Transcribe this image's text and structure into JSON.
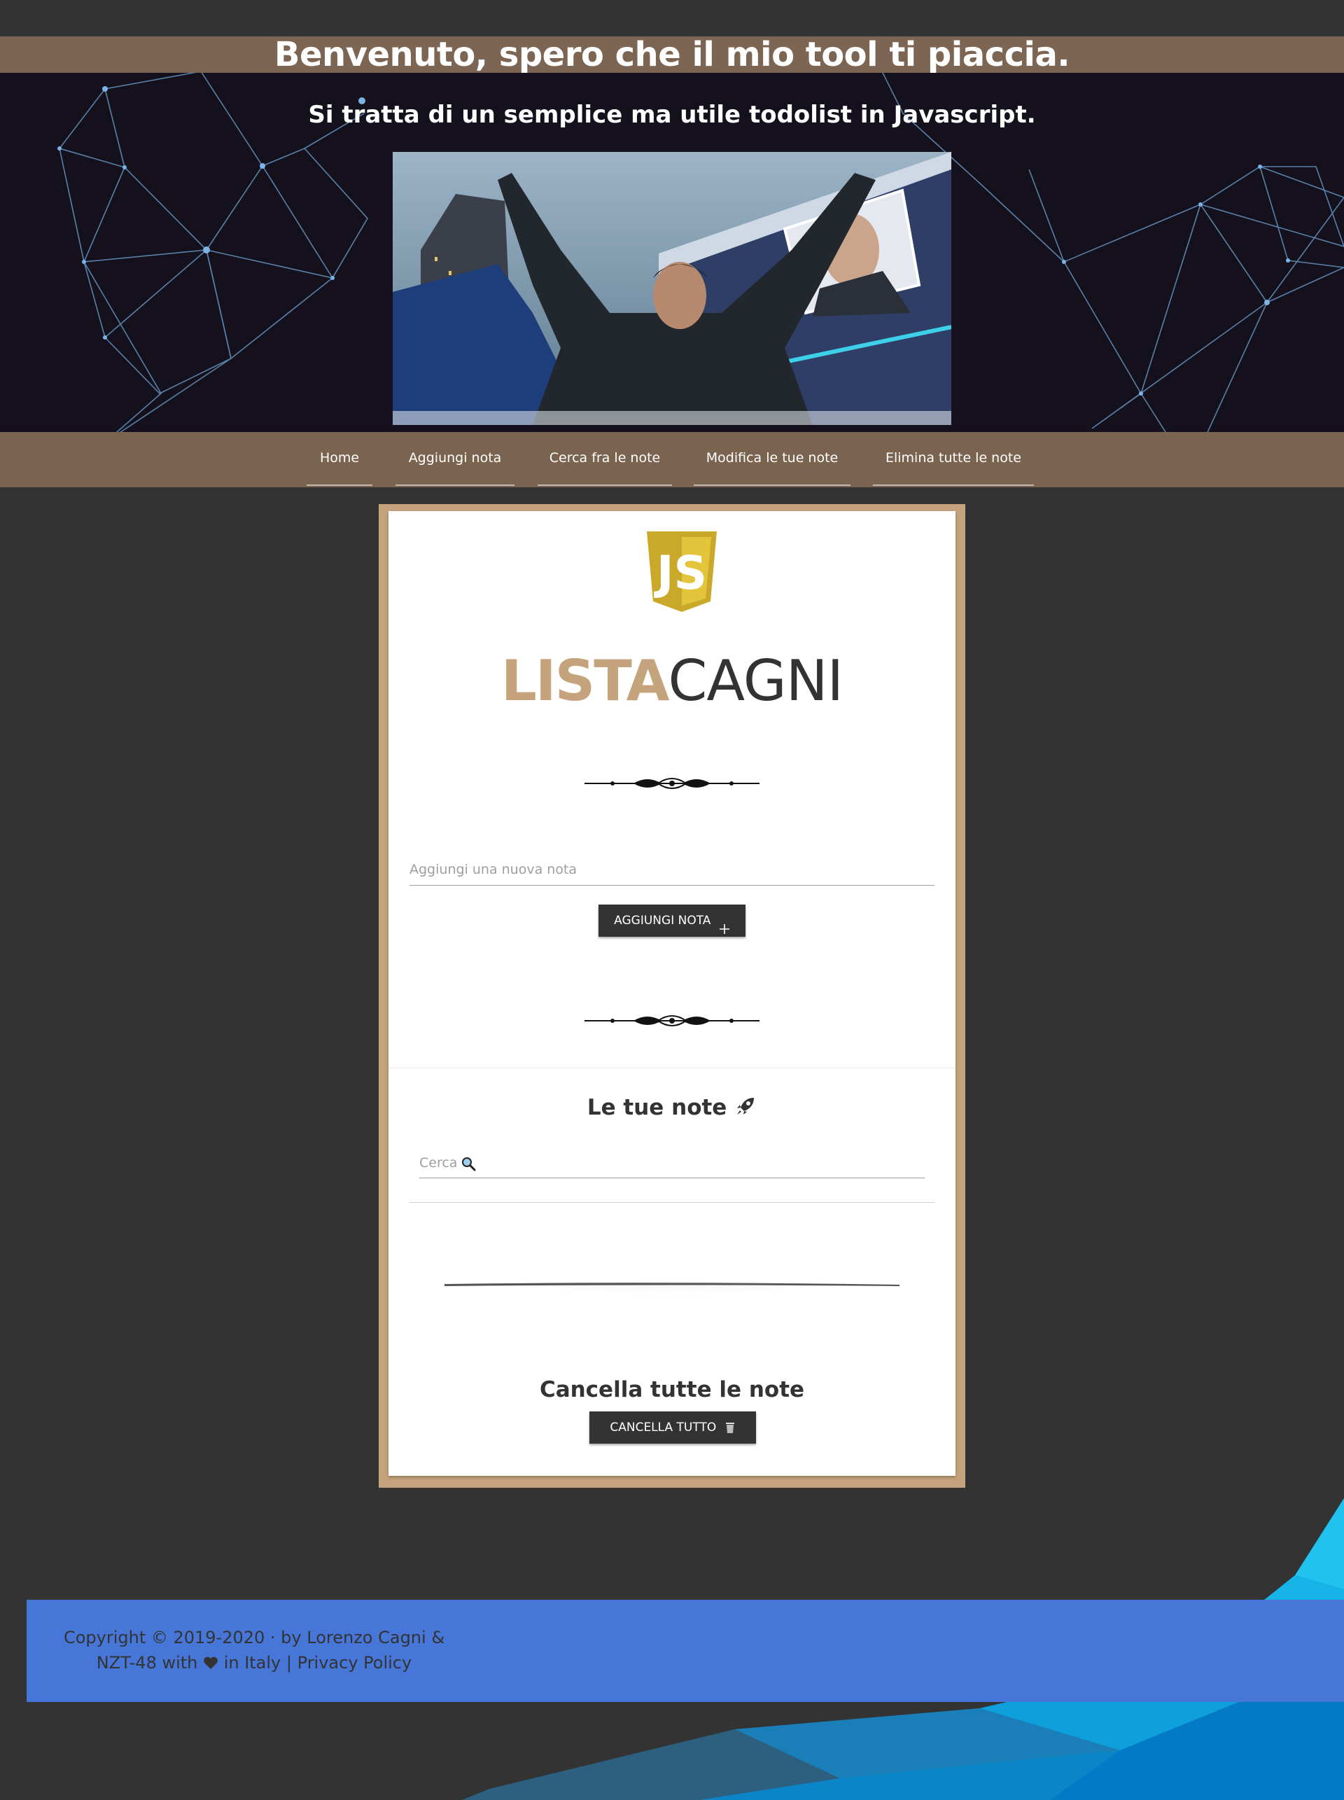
{
  "hero": {
    "title": "Benvenuto, spero che il mio tool ti piaccia.",
    "subtitle": "Si tratta di un semplice ma utile todolist in Javascript."
  },
  "nav": {
    "items": [
      {
        "label": "Home"
      },
      {
        "label": "Aggiungi nota"
      },
      {
        "label": "Cerca fra le note"
      },
      {
        "label": "Modifica le tue note"
      },
      {
        "label": "Elimina tutte le note"
      }
    ]
  },
  "brand": {
    "part1": "LISTA",
    "part2": "CAGNI",
    "logo_text": "JS"
  },
  "note_form": {
    "placeholder": "Aggiungi una nuova nota",
    "value": "",
    "add_button": "AGGIUNGI NOTA",
    "add_icon": "plus-icon"
  },
  "notes": {
    "heading": "Le tue note",
    "heading_icon": "rocket-icon",
    "search_placeholder": "Cerca",
    "search_icon": "magnifier-icon",
    "items": []
  },
  "delete_all": {
    "heading": "Cancella tutte le note",
    "button": "CANCELLA TUTTO",
    "button_icon": "trash-icon"
  },
  "footer": {
    "text": "Copyright © 2019-2020 · by Lorenzo Cagni & NZT-48 with",
    "heart_icon": "heart-icon",
    "text2": "in Italy",
    "separator": "|",
    "privacy_link": "Privacy Policy"
  },
  "colors": {
    "page_bg": "#333333",
    "hero_band": "#7c6552",
    "navbar": "#7a6450",
    "accent_gold": "#c4a37d",
    "js_yellow": "#d6b72a",
    "footer_blue": "#4677d8",
    "button_dark": "#333333"
  }
}
